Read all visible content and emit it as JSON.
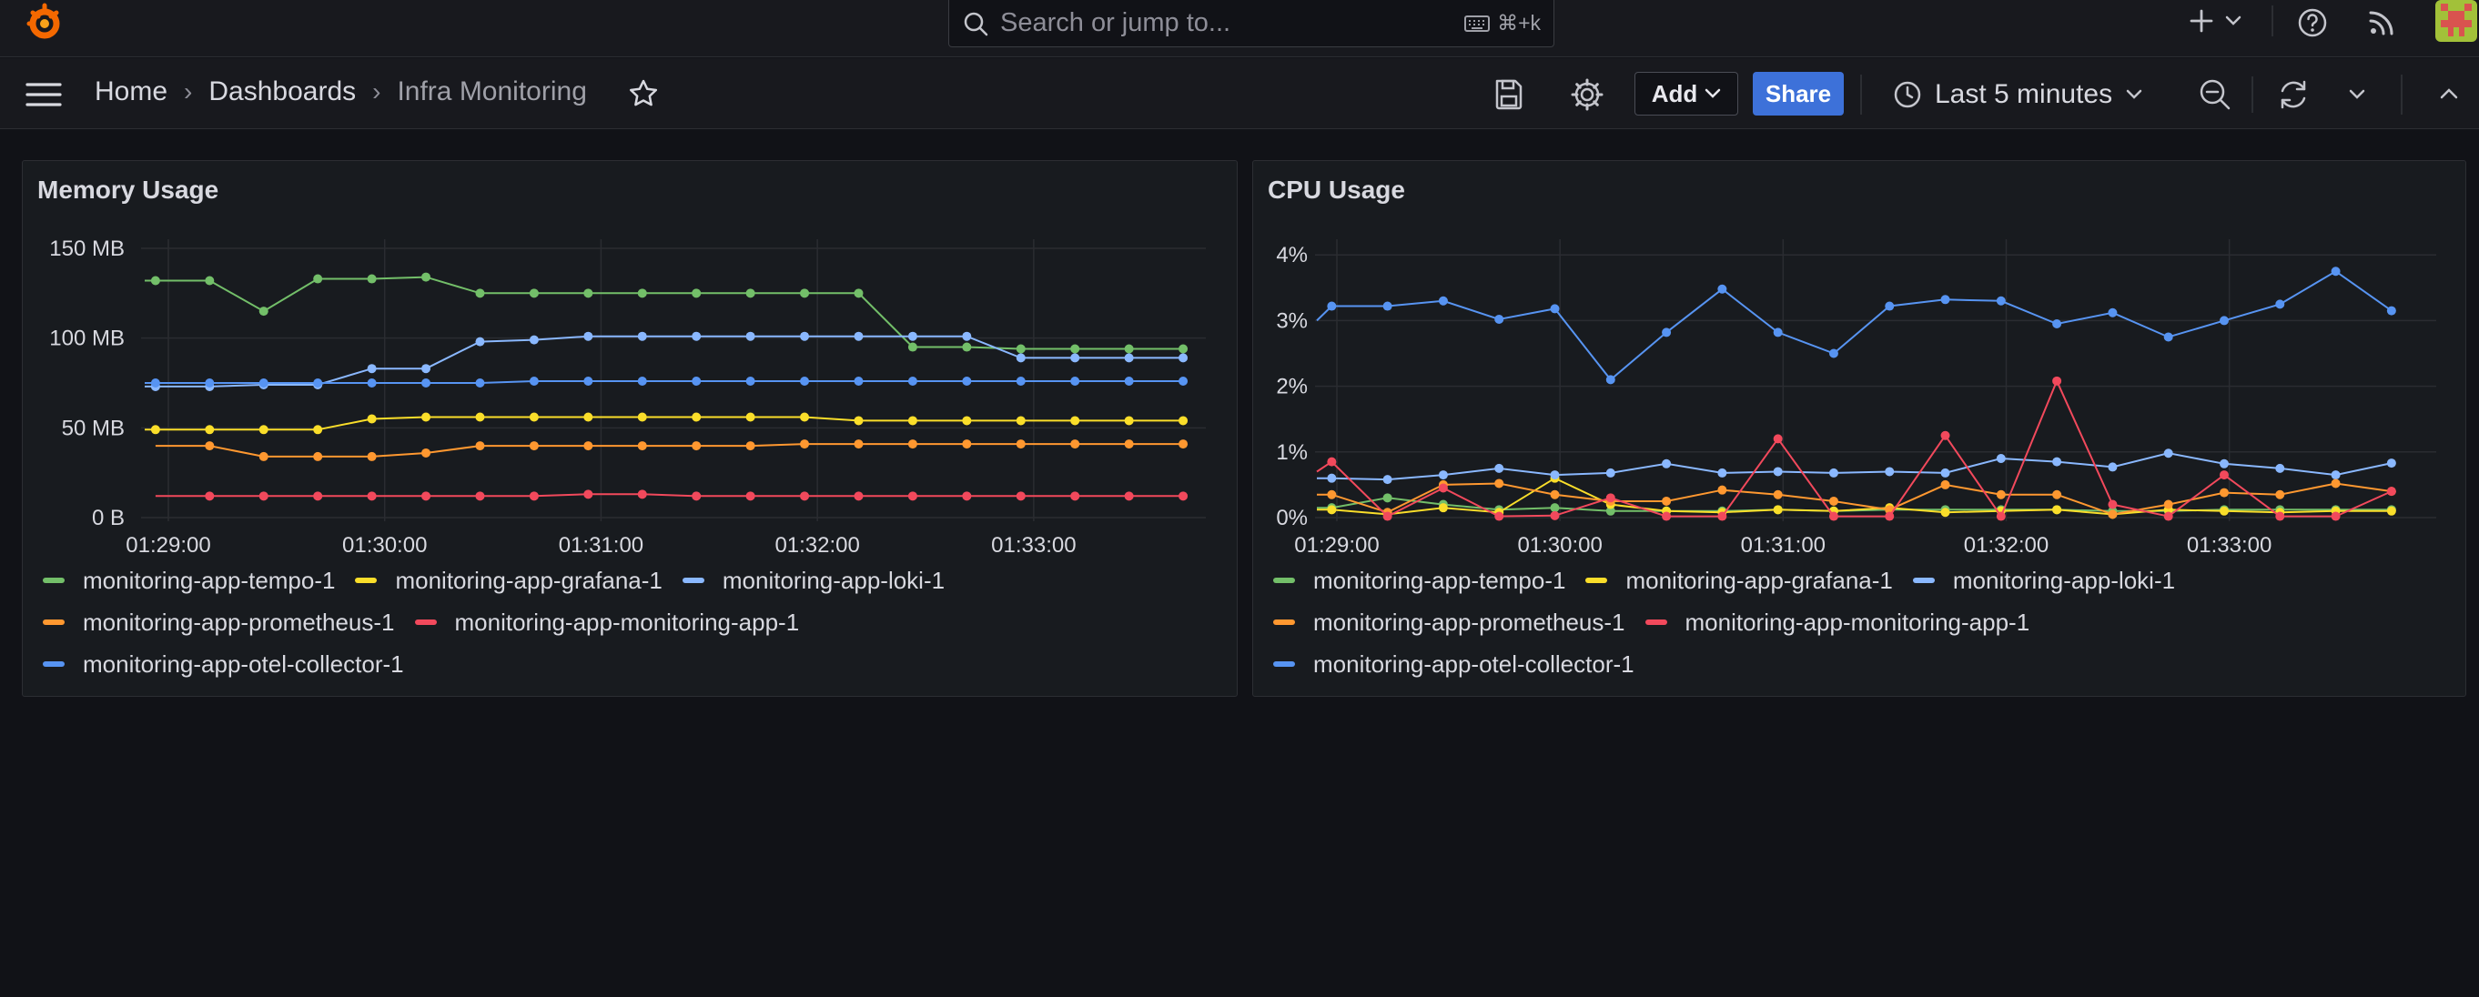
{
  "search": {
    "placeholder": "Search or jump to...",
    "shortcut": "⌘+k"
  },
  "breadcrumb": {
    "home": "Home",
    "dashboards": "Dashboards",
    "current": "Infra Monitoring"
  },
  "toolbar": {
    "add_label": "Add",
    "share_label": "Share",
    "time_range": "Last 5 minutes"
  },
  "colors": {
    "tempo": "#73bf69",
    "grafana": "#fade2a",
    "loki": "#8ab8ff",
    "prometheus": "#ff9830",
    "monitoring_app": "#f2495c",
    "otel": "#5794f2",
    "accent": "#3d71d9"
  },
  "legend": [
    [
      "monitoring-app-tempo-1",
      "monitoring-app-grafana-1",
      "monitoring-app-loki-1"
    ],
    [
      "monitoring-app-prometheus-1",
      "monitoring-app-monitoring-app-1"
    ],
    [
      "monitoring-app-otel-collector-1"
    ]
  ],
  "chart_data": [
    {
      "type": "line",
      "title": "Memory Usage",
      "x_ticks": [
        "01:29:00",
        "01:30:00",
        "01:31:00",
        "01:32:00",
        "01:33:00"
      ],
      "y_ticks": [
        "0 B",
        "50 MB",
        "100 MB",
        "150 MB"
      ],
      "ylim": [
        0,
        150
      ],
      "x_seconds_range": [
        0,
        290
      ],
      "grid": true,
      "legend_position": "bottom",
      "series": [
        {
          "name": "monitoring-app-tempo-1",
          "color": "#73bf69",
          "x": [
            0,
            3,
            18,
            33,
            48,
            63,
            78,
            93,
            108,
            123,
            138,
            153,
            168,
            183,
            198,
            213,
            228,
            243,
            258,
            273,
            288
          ],
          "y": [
            132,
            132,
            132,
            115,
            133,
            133,
            134,
            125,
            125,
            125,
            125,
            125,
            125,
            125,
            125,
            95,
            95,
            94,
            94,
            94,
            94
          ]
        },
        {
          "name": "monitoring-app-grafana-1",
          "color": "#fade2a",
          "x": [
            0,
            3,
            18,
            33,
            48,
            63,
            78,
            93,
            108,
            123,
            138,
            153,
            168,
            183,
            198,
            213,
            228,
            243,
            258,
            273,
            288
          ],
          "y": [
            49,
            49,
            49,
            49,
            49,
            55,
            56,
            56,
            56,
            56,
            56,
            56,
            56,
            56,
            54,
            54,
            54,
            54,
            54,
            54,
            54
          ]
        },
        {
          "name": "monitoring-app-loki-1",
          "color": "#8ab8ff",
          "x": [
            0,
            3,
            18,
            33,
            48,
            63,
            78,
            93,
            108,
            123,
            138,
            153,
            168,
            183,
            198,
            213,
            228,
            243,
            258,
            273,
            288
          ],
          "y": [
            73,
            73,
            73,
            74,
            74,
            83,
            83,
            98,
            99,
            101,
            101,
            101,
            101,
            101,
            101,
            101,
            101,
            89,
            89,
            89,
            89
          ]
        },
        {
          "name": "monitoring-app-prometheus-1",
          "color": "#ff9830",
          "x": [
            3,
            18,
            33,
            48,
            63,
            78,
            93,
            108,
            123,
            138,
            153,
            168,
            183,
            198,
            213,
            228,
            243,
            258,
            273,
            288
          ],
          "y": [
            40,
            40,
            34,
            34,
            34,
            36,
            40,
            40,
            40,
            40,
            40,
            40,
            41,
            41,
            41,
            41,
            41,
            41,
            41,
            41
          ]
        },
        {
          "name": "monitoring-app-monitoring-app-1",
          "color": "#f2495c",
          "x": [
            3,
            18,
            33,
            48,
            63,
            78,
            93,
            108,
            123,
            138,
            153,
            168,
            183,
            198,
            213,
            228,
            243,
            258,
            273,
            288
          ],
          "y": [
            12,
            12,
            12,
            12,
            12,
            12,
            12,
            12,
            13,
            13,
            12,
            12,
            12,
            12,
            12,
            12,
            12,
            12,
            12,
            12
          ]
        },
        {
          "name": "monitoring-app-otel-collector-1",
          "color": "#5794f2",
          "x": [
            0,
            3,
            18,
            33,
            48,
            63,
            78,
            93,
            108,
            123,
            138,
            153,
            168,
            183,
            198,
            213,
            228,
            243,
            258,
            273,
            288
          ],
          "y": [
            75,
            75,
            75,
            75,
            75,
            75,
            75,
            75,
            76,
            76,
            76,
            76,
            76,
            76,
            76,
            76,
            76,
            76,
            76,
            76,
            76
          ]
        }
      ]
    },
    {
      "type": "line",
      "title": "CPU Usage",
      "x_ticks": [
        "01:29:00",
        "01:30:00",
        "01:31:00",
        "01:32:00",
        "01:33:00"
      ],
      "y_ticks": [
        "0%",
        "1%",
        "2%",
        "3%",
        "4%"
      ],
      "ylim": [
        0,
        4.1
      ],
      "x_seconds_range": [
        0,
        290
      ],
      "grid": true,
      "legend_position": "bottom",
      "series": [
        {
          "name": "monitoring-app-tempo-1",
          "color": "#73bf69",
          "x": [
            0,
            4,
            19,
            34,
            49,
            64,
            79,
            94,
            109,
            124,
            139,
            154,
            169,
            184,
            199,
            214,
            229,
            244,
            259,
            274,
            289
          ],
          "y": [
            0.15,
            0.15,
            0.3,
            0.2,
            0.12,
            0.15,
            0.1,
            0.1,
            0.1,
            0.12,
            0.1,
            0.12,
            0.12,
            0.12,
            0.12,
            0.1,
            0.1,
            0.12,
            0.12,
            0.12,
            0.12
          ]
        },
        {
          "name": "monitoring-app-grafana-1",
          "color": "#fade2a",
          "x": [
            0,
            4,
            19,
            34,
            49,
            64,
            79,
            94,
            109,
            124,
            139,
            154,
            169,
            184,
            199,
            214,
            229,
            244,
            259,
            274,
            289
          ],
          "y": [
            0.12,
            0.12,
            0.05,
            0.15,
            0.08,
            0.6,
            0.2,
            0.1,
            0.08,
            0.12,
            0.1,
            0.15,
            0.08,
            0.1,
            0.12,
            0.05,
            0.12,
            0.1,
            0.08,
            0.1,
            0.1
          ]
        },
        {
          "name": "monitoring-app-loki-1",
          "color": "#8ab8ff",
          "x": [
            0,
            4,
            19,
            34,
            49,
            64,
            79,
            94,
            109,
            124,
            139,
            154,
            169,
            184,
            199,
            214,
            229,
            244,
            259,
            274,
            289
          ],
          "y": [
            0.6,
            0.6,
            0.58,
            0.65,
            0.75,
            0.65,
            0.68,
            0.82,
            0.68,
            0.7,
            0.68,
            0.7,
            0.68,
            0.9,
            0.85,
            0.77,
            0.98,
            0.82,
            0.75,
            0.65,
            0.83
          ]
        },
        {
          "name": "monitoring-app-prometheus-1",
          "color": "#ff9830",
          "x": [
            0,
            4,
            19,
            34,
            49,
            64,
            79,
            94,
            109,
            124,
            139,
            154,
            169,
            184,
            199,
            214,
            229,
            244,
            259,
            274,
            289
          ],
          "y": [
            0.35,
            0.35,
            0.08,
            0.5,
            0.52,
            0.35,
            0.25,
            0.25,
            0.42,
            0.35,
            0.25,
            0.12,
            0.5,
            0.35,
            0.35,
            0.05,
            0.2,
            0.38,
            0.35,
            0.52,
            0.4
          ]
        },
        {
          "name": "monitoring-app-monitoring-app-1",
          "color": "#f2495c",
          "x": [
            0,
            4,
            19,
            34,
            49,
            64,
            79,
            94,
            109,
            124,
            139,
            154,
            169,
            184,
            199,
            214,
            229,
            244,
            259,
            274,
            289
          ],
          "y": [
            0.7,
            0.85,
            0.02,
            0.45,
            0.02,
            0.03,
            0.3,
            0.02,
            0.02,
            1.2,
            0.02,
            0.02,
            1.25,
            0.02,
            2.08,
            0.2,
            0.02,
            0.65,
            0.02,
            0.02,
            0.4
          ]
        },
        {
          "name": "monitoring-app-otel-collector-1",
          "color": "#5794f2",
          "x": [
            0,
            4,
            19,
            34,
            49,
            64,
            79,
            94,
            109,
            124,
            139,
            154,
            169,
            184,
            199,
            214,
            229,
            244,
            259,
            274,
            289
          ],
          "y": [
            3.0,
            3.22,
            3.22,
            3.3,
            3.02,
            3.18,
            2.1,
            2.82,
            3.48,
            2.82,
            2.5,
            3.22,
            3.32,
            3.3,
            2.95,
            3.12,
            2.75,
            3.0,
            3.25,
            3.75,
            3.15
          ]
        }
      ]
    }
  ]
}
